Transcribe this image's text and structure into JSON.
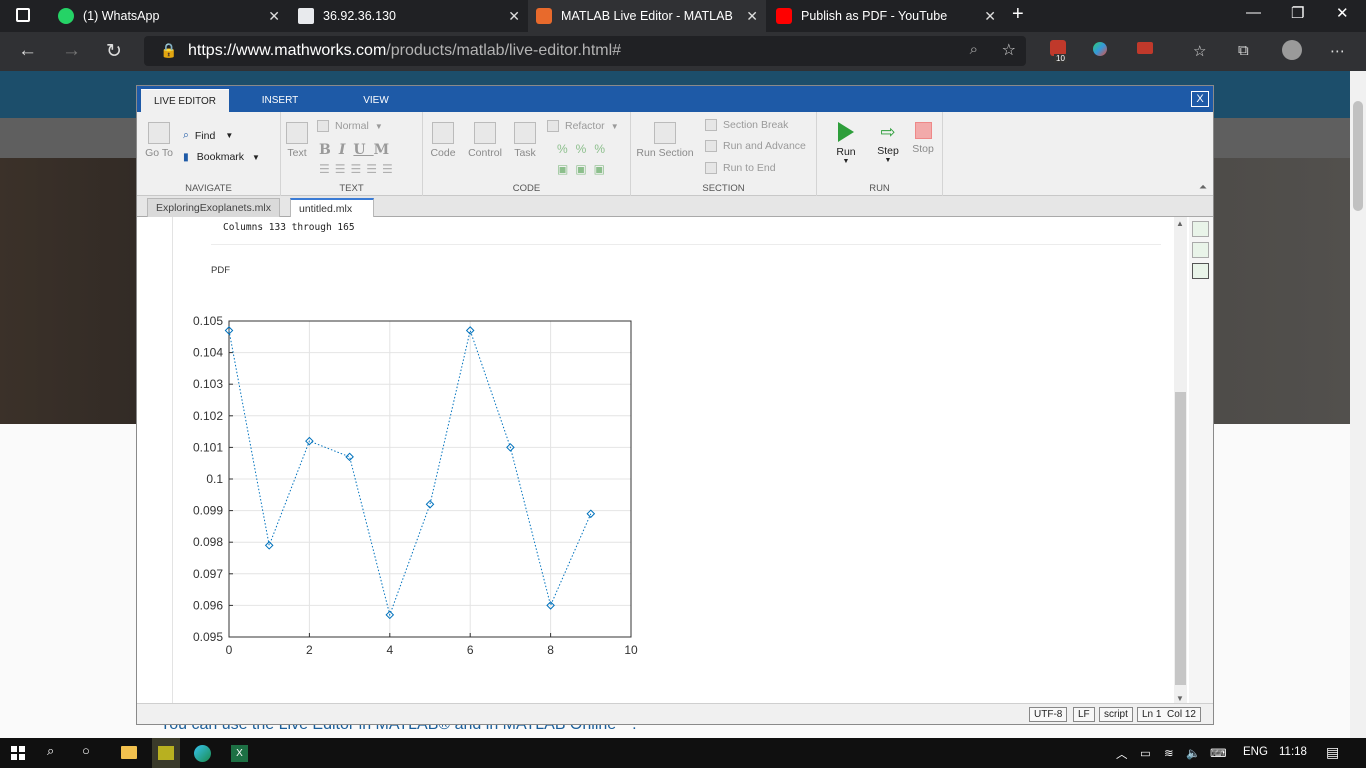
{
  "browser": {
    "tabs": [
      {
        "title": "(1) WhatsApp",
        "icon": "whatsapp-icon",
        "color": "#25d366"
      },
      {
        "title": "36.92.36.130",
        "icon": "page-icon",
        "color": "#e8eaed"
      },
      {
        "title": "MATLAB Live Editor - MATLAB",
        "icon": "matlab-icon",
        "color": "#e86a2c"
      },
      {
        "title": "Publish as PDF - YouTube",
        "icon": "youtube-icon",
        "color": "#ff0000"
      }
    ],
    "url_host": "https://www.mathworks.com",
    "url_path": "/products/matlab/live-editor.html#",
    "extension_badge": "10"
  },
  "page": {
    "bottom_text": "You can use the Live Editor in MATLAB® and in MATLAB Online™."
  },
  "editor": {
    "ribbon_tabs": [
      "LIVE EDITOR",
      "INSERT",
      "VIEW"
    ],
    "active_tab": "LIVE EDITOR",
    "close_label": "X",
    "navigate": {
      "goto": "Go To",
      "find": "Find",
      "bookmark": "Bookmark",
      "label": "NAVIGATE"
    },
    "text": {
      "text_btn": "Text",
      "style": "Normal",
      "bold": "B",
      "italic": "I",
      "underline": "U",
      "mono": "M",
      "label": "TEXT"
    },
    "code": {
      "code_btn": "Code",
      "control": "Control",
      "task": "Task",
      "refactor": "Refactor",
      "label": "CODE"
    },
    "section": {
      "run_section": "Run Section",
      "section_break": "Section Break",
      "run_advance": "Run and Advance",
      "run_end": "Run to End",
      "label": "SECTION"
    },
    "run": {
      "run": "Run",
      "step": "Step",
      "stop": "Stop",
      "label": "RUN"
    },
    "files": [
      "ExploringExoplanets.mlx",
      "untitled.mlx"
    ],
    "active_file": "untitled.mlx",
    "output_line": "Columns 133 through 165",
    "output_label": "PDF",
    "status": {
      "encoding": "UTF-8",
      "eol": "LF",
      "type": "script",
      "ln_label": "Ln",
      "ln": "1",
      "col_label": "Col",
      "col": "12"
    }
  },
  "chart_data": {
    "type": "line",
    "x": [
      0,
      1,
      2,
      3,
      4,
      5,
      6,
      7,
      8,
      9
    ],
    "series": [
      {
        "values": [
          0.1047,
          0.0979,
          0.1012,
          0.1007,
          0.0957,
          0.0992,
          0.1047,
          0.101,
          0.096,
          0.0989
        ]
      }
    ],
    "xlim": [
      0,
      10
    ],
    "ylim": [
      0.095,
      0.105
    ],
    "xticks": [
      "0",
      "2",
      "4",
      "6",
      "8",
      "10"
    ],
    "yticks": [
      "0.105",
      "0.104",
      "0.103",
      "0.102",
      "0.101",
      "0.1",
      "0.099",
      "0.098",
      "0.097",
      "0.096",
      "0.095"
    ],
    "grid": true,
    "line_style": "dotted",
    "marker": "diamond",
    "color": "#0072bd"
  },
  "taskbar": {
    "lang": "ENG",
    "time": "11:18"
  }
}
